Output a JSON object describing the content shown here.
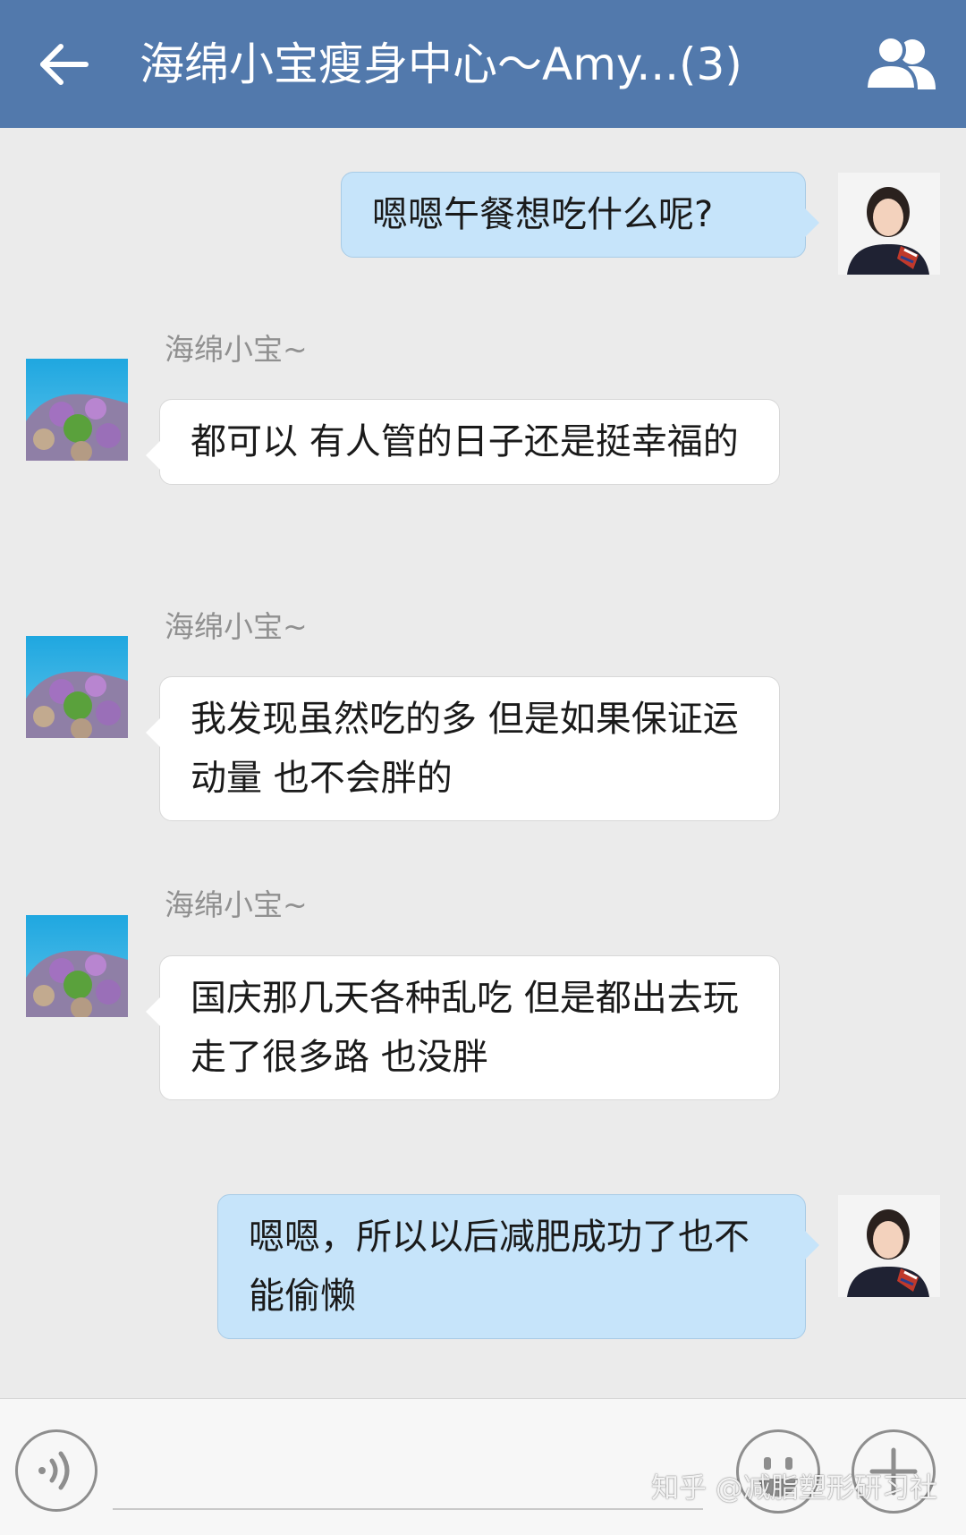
{
  "header": {
    "title": "海绵小宝瘦身中心～Amy...(3)"
  },
  "messages": [
    {
      "direction": "out",
      "sender": "",
      "text": "嗯嗯午餐想吃什么呢?"
    },
    {
      "direction": "in",
      "sender": "海绵小宝~",
      "text": "都可以 有人管的日子还是挺幸福的"
    },
    {
      "direction": "in",
      "sender": "海绵小宝~",
      "text": "我发现虽然吃的多 但是如果保证运动量 也不会胖的"
    },
    {
      "direction": "in",
      "sender": "海绵小宝~",
      "text": "国庆那几天各种乱吃 但是都出去玩走了很多路 也没胖"
    },
    {
      "direction": "out",
      "sender": "",
      "text": "嗯嗯，所以以后减肥成功了也不能偷懒"
    }
  ],
  "input_bar": {
    "text_value": "",
    "watermark": "知乎 @减脂塑形研习社"
  },
  "icons": {
    "back": "arrow-left-icon",
    "members": "group-members-icon",
    "voice": "voice-icon",
    "emoji": "emoji-icon",
    "plus": "plus-icon"
  },
  "colors": {
    "header_bg": "#5279ac",
    "chat_bg": "#ebebeb",
    "incoming_bubble": "#ffffff",
    "outgoing_bubble": "#c6e4fa"
  }
}
